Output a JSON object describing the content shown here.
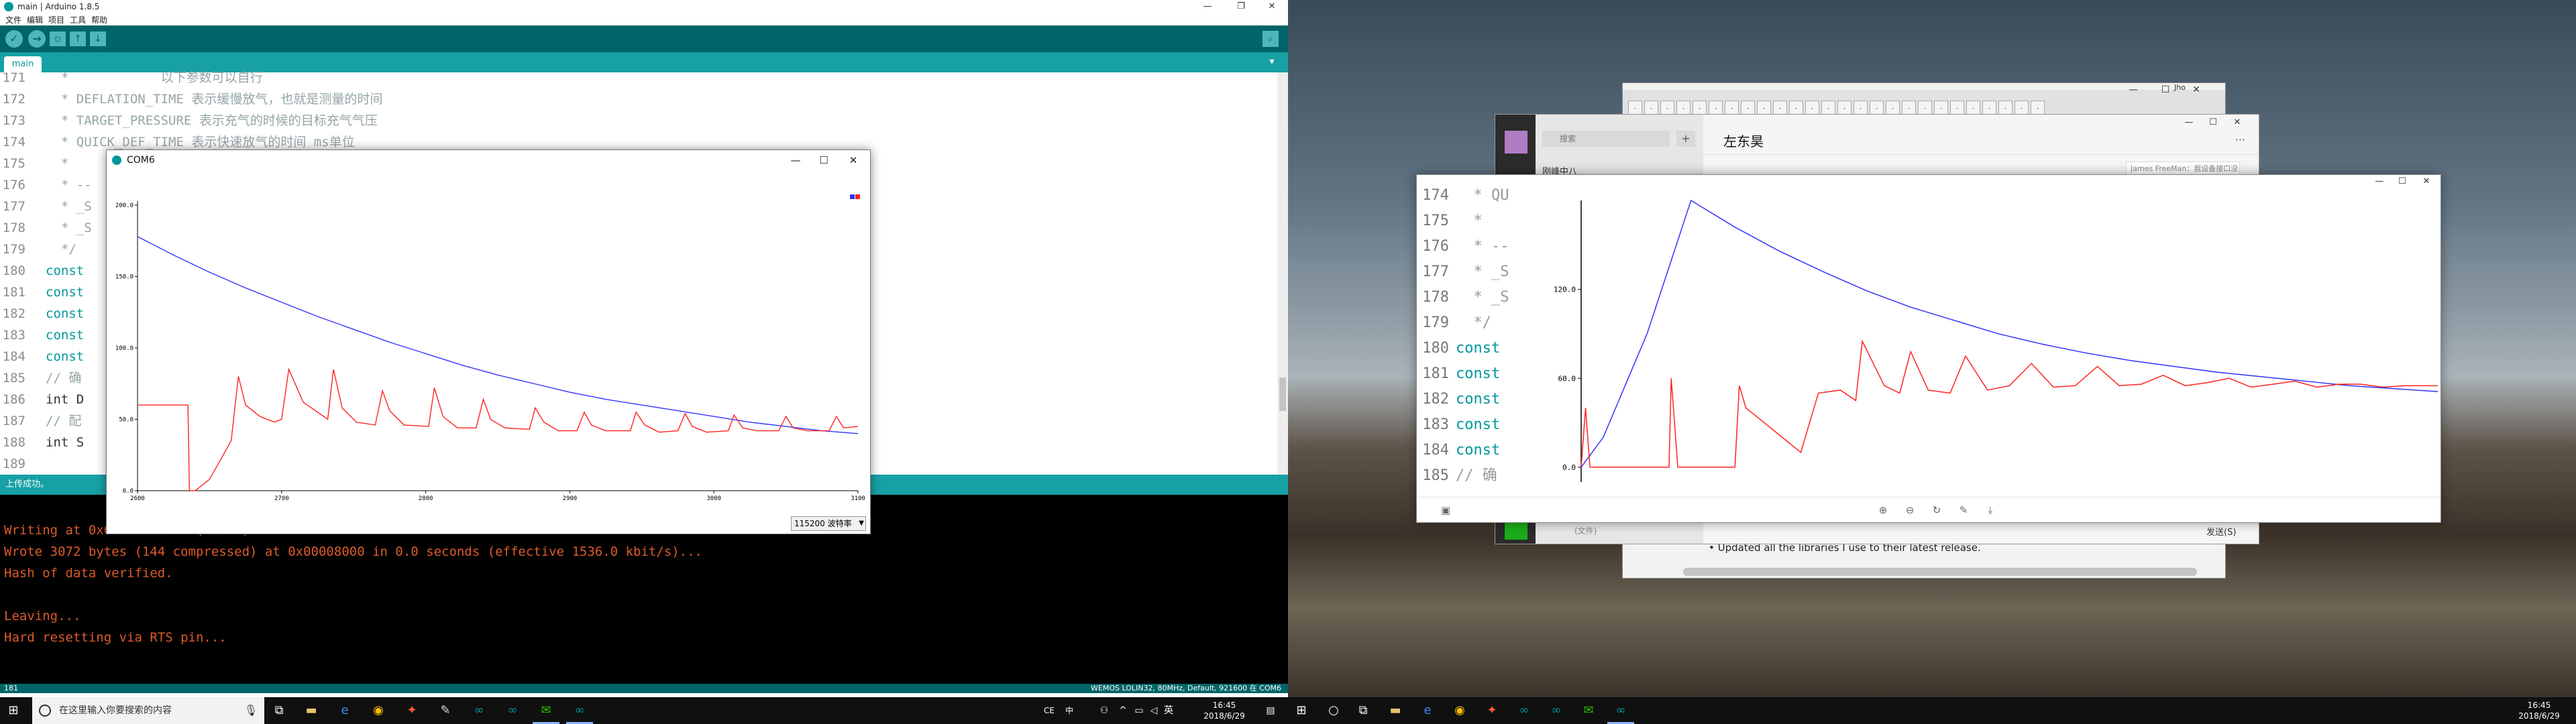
{
  "arduino": {
    "window_title": "main | Arduino 1.8.5",
    "menu": [
      "文件",
      "编辑",
      "项目",
      "工具",
      "帮助"
    ],
    "tab_label": "main",
    "code_lines": [
      {
        "num": "171",
        "text": "  *            以下参数可以自行",
        "style": "comment"
      },
      {
        "num": "172",
        "text": "  * DEFLATION_TIME 表示缓慢放气，也就是测量的时间",
        "style": "comment"
      },
      {
        "num": "173",
        "text": "  * TARGET_PRESSURE 表示充气的时候的目标充气气压",
        "style": "comment"
      },
      {
        "num": "174",
        "text": "  * QUICK_DEF_TIME 表示快速放气的时间 ms单位",
        "style": "comment"
      },
      {
        "num": "175",
        "text": "  * ",
        "style": "comment"
      },
      {
        "num": "176",
        "text": "  * --",
        "style": "comment"
      },
      {
        "num": "177",
        "text": "  * _S",
        "style": "comment"
      },
      {
        "num": "178",
        "text": "  * _S",
        "style": "comment"
      },
      {
        "num": "179",
        "text": "  */",
        "style": "comment"
      },
      {
        "num": "180",
        "text": "const",
        "style": "keyword"
      },
      {
        "num": "181",
        "text": "const",
        "style": "keyword"
      },
      {
        "num": "182",
        "text": "const",
        "style": "keyword"
      },
      {
        "num": "183",
        "text": "const",
        "style": "keyword"
      },
      {
        "num": "184",
        "text": "const",
        "style": "keyword"
      },
      {
        "num": "185",
        "text": "// 确",
        "style": "comment"
      },
      {
        "num": "186",
        "text": "int D",
        "style": "plain"
      },
      {
        "num": "187",
        "text": "// 配",
        "style": "comment"
      },
      {
        "num": "188",
        "text": "int S",
        "style": "plain"
      },
      {
        "num": "189",
        "text": "",
        "style": "plain"
      }
    ],
    "status_text": "上传成功。",
    "console_lines": [
      "Writing at 0x00000000... (100 %)",
      "Wrote 3072 bytes (144 compressed) at 0x00008000 in 0.0 seconds (effective 1536.0 kbit/s)...",
      "Hash of data verified.",
      "",
      "Leaving...",
      "Hard resetting via RTS pin..."
    ],
    "bottom_left": "181",
    "bottom_right": "WEMOS LOLIN32, 80MHz, Default, 921600 在 COM6"
  },
  "plotter": {
    "title": "COM6",
    "baud_label": "115200 波特率",
    "colors": {
      "series1": "#3333ff",
      "series2": "#ff2222",
      "axis": "#000000"
    }
  },
  "chart_data": [
    {
      "type": "line",
      "title": "",
      "xlabel": "",
      "ylabel": "",
      "x_ticks": [
        2600,
        2700,
        2800,
        2900,
        3000,
        3100
      ],
      "y_ticks": [
        "0.0",
        "50.0",
        "100.0",
        "150.0",
        "200.0"
      ],
      "xlim": [
        2600,
        3100
      ],
      "ylim": [
        0,
        200
      ],
      "series": [
        {
          "color": "#3333ff",
          "x": [
            2600,
            2625,
            2650,
            2675,
            2700,
            2725,
            2750,
            2775,
            2800,
            2825,
            2850,
            2875,
            2900,
            2925,
            2950,
            2975,
            3000,
            3025,
            3050,
            3075,
            3100
          ],
          "values": [
            178,
            165,
            153,
            142,
            132,
            122,
            113,
            104,
            96,
            88,
            81,
            75,
            69,
            64,
            60,
            56,
            52,
            48,
            45,
            42,
            40
          ]
        },
        {
          "color": "#ff2222",
          "x": [
            2600,
            2635,
            2636,
            2640,
            2650,
            2665,
            2670,
            2675,
            2685,
            2695,
            2700,
            2705,
            2715,
            2732,
            2736,
            2742,
            2752,
            2765,
            2770,
            2775,
            2785,
            2802,
            2806,
            2812,
            2822,
            2835,
            2840,
            2845,
            2855,
            2872,
            2876,
            2882,
            2892,
            2905,
            2910,
            2915,
            2925,
            2942,
            2946,
            2952,
            2962,
            2975,
            2980,
            2985,
            2995,
            3010,
            3014,
            3020,
            3030,
            3045,
            3050,
            3055,
            3065,
            3080,
            3085,
            3090,
            3100
          ],
          "values": [
            60,
            60,
            0,
            0,
            8,
            35,
            80,
            60,
            52,
            48,
            50,
            85,
            62,
            50,
            85,
            58,
            48,
            46,
            70,
            56,
            46,
            45,
            72,
            52,
            44,
            44,
            64,
            50,
            44,
            43,
            58,
            48,
            42,
            42,
            55,
            46,
            42,
            42,
            55,
            46,
            41,
            42,
            54,
            45,
            41,
            42,
            53,
            44,
            42,
            42,
            52,
            44,
            42,
            42,
            52,
            44,
            45
          ]
        }
      ]
    },
    {
      "type": "line",
      "title": "",
      "xlabel": "",
      "ylabel": "",
      "y_ticks": [
        "0.0",
        "60.0",
        "120.0"
      ],
      "ylim": [
        -10,
        180
      ],
      "series": [
        {
          "color": "#3333ff",
          "x": [
            0,
            10,
            30,
            50,
            70,
            90,
            110,
            130,
            150,
            170,
            190,
            210,
            230,
            250,
            270,
            290,
            310,
            330,
            350,
            370,
            390
          ],
          "values": [
            0,
            20,
            90,
            180,
            162,
            146,
            132,
            119,
            108,
            99,
            90,
            83,
            77,
            72,
            68,
            64,
            61,
            58,
            55,
            53,
            51
          ]
        },
        {
          "color": "#ff2222",
          "x": [
            0,
            2,
            4,
            40,
            41,
            44,
            70,
            72,
            75,
            100,
            105,
            108,
            118,
            125,
            128,
            138,
            145,
            150,
            158,
            168,
            175,
            185,
            195,
            205,
            215,
            225,
            235,
            245,
            255,
            265,
            275,
            285,
            295,
            305,
            315,
            325,
            335,
            345,
            355,
            365,
            375,
            385,
            390
          ],
          "values": [
            0,
            40,
            0,
            0,
            60,
            0,
            0,
            55,
            40,
            10,
            35,
            50,
            52,
            45,
            85,
            55,
            50,
            78,
            52,
            50,
            75,
            52,
            55,
            70,
            54,
            55,
            68,
            55,
            56,
            62,
            55,
            57,
            60,
            54,
            56,
            58,
            54,
            56,
            56,
            54,
            55,
            55,
            55
          ]
        }
      ]
    }
  ],
  "taskbar_left": {
    "search_placeholder": "在这里输入你要搜索的内容",
    "time": "16:45",
    "date": "2018/6/29",
    "ime": "中",
    "tray_label": "CE"
  },
  "taskbar_right": {
    "time": "16:45",
    "date": "2018/6/29"
  },
  "chrome": {
    "user": "Jho",
    "bullet_text": "Updated all the libraries I use to their latest release."
  },
  "wechat": {
    "search_placeholder": "搜索",
    "contact_name": "左东昊",
    "list_item": "刚峰中八",
    "message_preview": "James FreeMan：我设备接口没有",
    "send_label": "发送(S)",
    "file_label": "(文件)"
  },
  "plot2_code": [
    {
      "num": "174",
      "text": "  * QU",
      "style": "comment"
    },
    {
      "num": "175",
      "text": "  *",
      "style": "comment"
    },
    {
      "num": "176",
      "text": "  * --",
      "style": "comment"
    },
    {
      "num": "177",
      "text": "  * _S",
      "style": "comment"
    },
    {
      "num": "178",
      "text": "  * _S",
      "style": "comment"
    },
    {
      "num": "179",
      "text": "  */",
      "style": "comment"
    },
    {
      "num": "180",
      "text": "const",
      "style": "keyword"
    },
    {
      "num": "181",
      "text": "const",
      "style": "keyword"
    },
    {
      "num": "182",
      "text": "const",
      "style": "keyword"
    },
    {
      "num": "183",
      "text": "const",
      "style": "keyword"
    },
    {
      "num": "184",
      "text": "const",
      "style": "keyword"
    },
    {
      "num": "185",
      "text": "// 确",
      "style": "comment"
    }
  ]
}
